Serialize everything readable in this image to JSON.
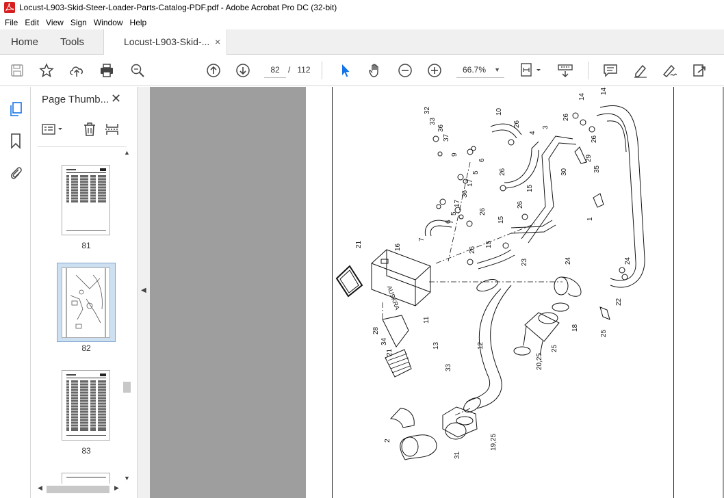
{
  "window": {
    "title": "Locust-L903-Skid-Steer-Loader-Parts-Catalog-PDF.pdf - Adobe Acrobat Pro DC (32-bit)"
  },
  "menu": [
    "File",
    "Edit",
    "View",
    "Sign",
    "Window",
    "Help"
  ],
  "tabs": {
    "home": "Home",
    "tools": "Tools",
    "document": "Locust-L903-Skid-...",
    "close_glyph": "×"
  },
  "toolbar": {
    "current_page": "82",
    "page_separator": "/",
    "total_pages": "112",
    "zoom": "66.7%",
    "icons": [
      "save-icon",
      "bookmark-star-icon",
      "upload-icon",
      "print-icon",
      "zoom-search-icon",
      "page-up-icon",
      "page-down-icon",
      "select-arrow-icon",
      "hand-icon",
      "zoom-out-icon",
      "zoom-in-icon",
      "fit-page-icon",
      "scroll-mode-icon",
      "comment-icon",
      "highlight-icon",
      "sign-icon",
      "share-icon"
    ]
  },
  "side_rail": {
    "icons": [
      "page-thumbnails-icon",
      "bookmarks-icon",
      "attachments-icon"
    ]
  },
  "thumbnail_panel": {
    "title": "Page Thumb...",
    "close_glyph": "✕",
    "thumbnails": [
      {
        "page": "81",
        "selected": false
      },
      {
        "page": "82",
        "selected": true
      },
      {
        "page": "83",
        "selected": false
      }
    ]
  },
  "drawing": {
    "callouts": [
      "32",
      "33",
      "36",
      "37",
      "9",
      "6",
      "5",
      "17",
      "36",
      "17",
      "5",
      "6",
      "7",
      "10",
      "26",
      "4",
      "3",
      "26",
      "14",
      "14",
      "26",
      "29",
      "30",
      "35",
      "26",
      "15",
      "26",
      "15",
      "26",
      "15",
      "26",
      "23",
      "1",
      "16",
      "21",
      "24",
      "24",
      "22",
      "25",
      "18",
      "25",
      "20,25",
      "12",
      "11",
      "13",
      "33",
      "28",
      "34",
      "21",
      "2",
      "31",
      "19,25"
    ]
  },
  "colors": {
    "accent": "#1473e6",
    "viewer_bg": "#9e9e9e",
    "selected_thumb": "#cde0f2"
  }
}
